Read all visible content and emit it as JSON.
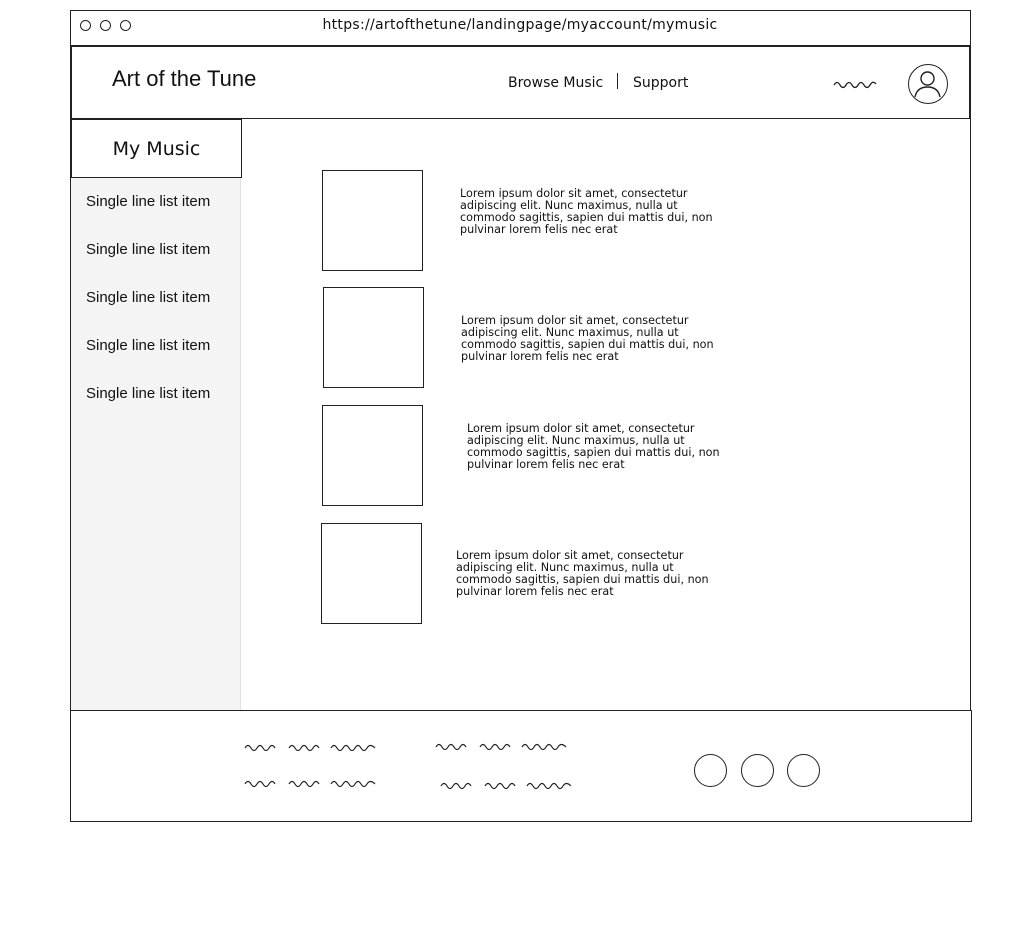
{
  "browser": {
    "url": "https://artofthetune/landingpage/myaccount/mymusic"
  },
  "header": {
    "brand": "Art of the Tune",
    "nav": [
      {
        "label": "Browse Music"
      },
      {
        "label": "Support"
      }
    ]
  },
  "sidebar": {
    "title": "My Music",
    "items": [
      {
        "label": "Single line list item"
      },
      {
        "label": "Single line list item"
      },
      {
        "label": "Single line list item"
      },
      {
        "label": "Single line list item"
      },
      {
        "label": "Single line list item"
      }
    ]
  },
  "music": {
    "items": [
      {
        "description": "Lorem ipsum dolor sit amet, consectetur adipiscing elit. Nunc maximus, nulla ut commodo sagittis, sapien dui mattis dui, non pulvinar lorem felis nec erat"
      },
      {
        "description": "Lorem ipsum dolor sit amet, consectetur adipiscing elit. Nunc maximus, nulla ut commodo sagittis, sapien dui mattis dui, non pulvinar lorem felis nec erat"
      },
      {
        "description": "Lorem ipsum dolor sit amet, consectetur adipiscing elit. Nunc maximus, nulla ut commodo sagittis, sapien dui mattis dui, non pulvinar lorem felis nec erat"
      },
      {
        "description": "Lorem ipsum dolor sit amet, consectetur adipiscing elit. Nunc maximus, nulla ut commodo sagittis, sapien dui mattis dui, non pulvinar lorem felis nec erat"
      }
    ]
  },
  "icons": {
    "window_controls": [
      "window-dot-icon",
      "window-dot-icon",
      "window-dot-icon"
    ],
    "avatar": "user-avatar-icon",
    "footer_social": [
      "social-circle-icon",
      "social-circle-icon",
      "social-circle-icon"
    ]
  }
}
